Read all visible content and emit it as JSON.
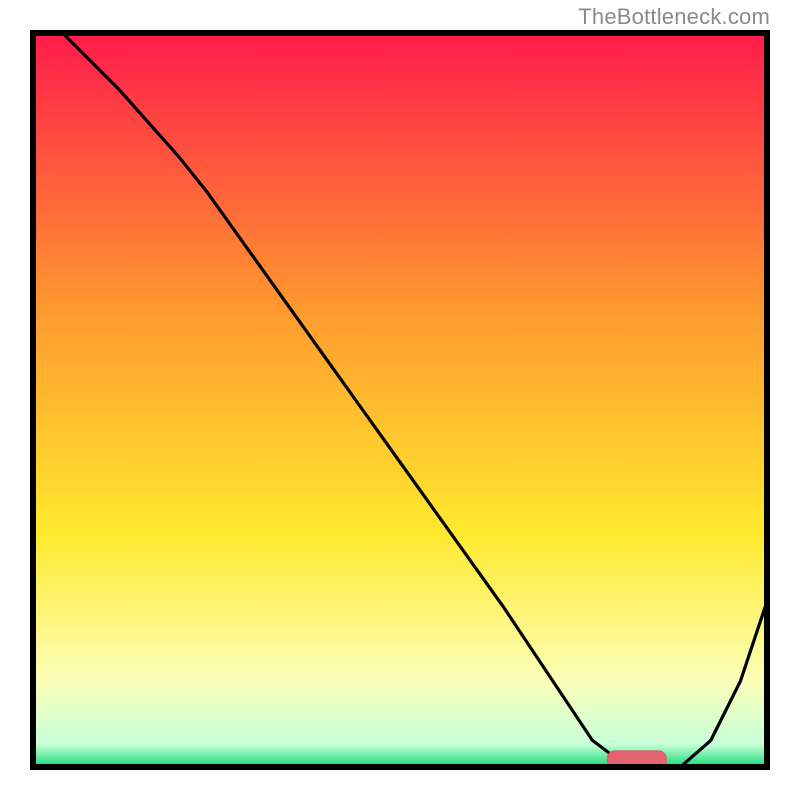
{
  "attribution": "TheBottleneck.com",
  "colors": {
    "gradient_top": "#ff1a4b",
    "gradient_orange": "#ff9a2e",
    "gradient_yellow": "#ffe92e",
    "gradient_pale": "#fbffb8",
    "gradient_green": "#00d66b",
    "border": "#000000",
    "curve": "#000000",
    "marker_fill": "#e2636f",
    "marker_stroke": "#dd5864"
  },
  "chart_data": {
    "type": "line",
    "xlabel": "",
    "ylabel": "",
    "xlim": [
      0,
      100
    ],
    "ylim": [
      0,
      100
    ],
    "title": "",
    "grid": false,
    "series": [
      {
        "name": "bottleneck-curve",
        "x": [
          4,
          12,
          20,
          24,
          34,
          44,
          54,
          64,
          72,
          76,
          80,
          84,
          88,
          92,
          96,
          100
        ],
        "y": [
          100,
          92,
          83,
          78,
          64,
          50,
          36,
          22,
          10,
          4,
          1,
          0.5,
          0.5,
          4,
          12,
          24
        ]
      }
    ],
    "marker": {
      "x_start": 78,
      "x_end": 86,
      "y": 1.5
    }
  }
}
